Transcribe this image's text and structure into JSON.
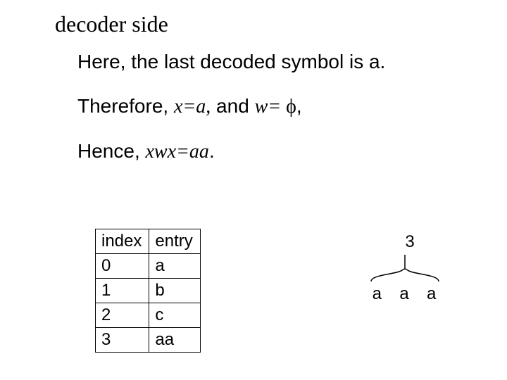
{
  "title": "decoder side",
  "lines": {
    "l1": "Here, the last decoded symbol is a.",
    "l2_prefix": "Therefore, ",
    "l2_x": "x=a,",
    "l2_mid": " and ",
    "l2_w": "w= ",
    "l2_phi": "ϕ",
    "l2_suffix": ",",
    "l3_prefix": "Hence,  ",
    "l3_expr": "xwx=aa",
    "l3_suffix": "."
  },
  "table": {
    "headers": {
      "c0": "index",
      "c1": "entry"
    },
    "rows": [
      {
        "c0": "0",
        "c1": "a"
      },
      {
        "c0": "1",
        "c1": "b"
      },
      {
        "c0": "2",
        "c1": "c"
      },
      {
        "c0": "3",
        "c1": "aa"
      }
    ]
  },
  "diagram": {
    "top": "3",
    "expansion": [
      "a",
      "a",
      "a"
    ]
  }
}
